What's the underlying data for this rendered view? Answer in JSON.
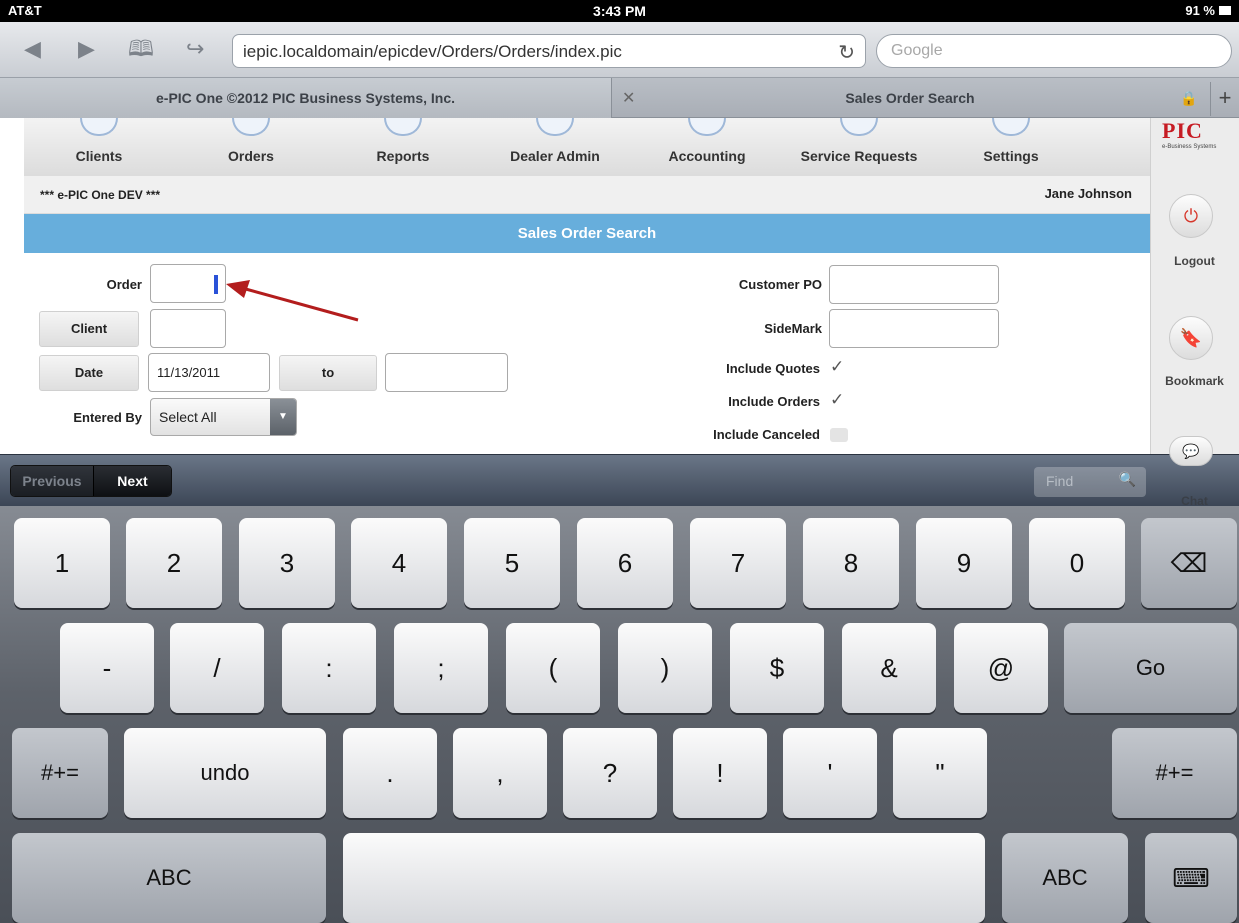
{
  "status_bar": {
    "carrier": "AT&T",
    "time": "3:43 PM",
    "battery": "91 %"
  },
  "browser": {
    "url": "iepic.localdomain/epicdev/Orders/Orders/index.pic",
    "search_placeholder": "Google",
    "tabs": [
      {
        "title": "e-PIC One  ©2012 PIC Business Systems, Inc."
      },
      {
        "title": "Sales Order Search"
      }
    ]
  },
  "nav": {
    "items": [
      {
        "label": "Clients"
      },
      {
        "label": "Orders"
      },
      {
        "label": "Reports"
      },
      {
        "label": "Dealer Admin"
      },
      {
        "label": "Accounting"
      },
      {
        "label": "Service Requests"
      },
      {
        "label": "Settings"
      }
    ]
  },
  "sidebar": {
    "logo_text": "PIC",
    "logo_sub": "e-Business Systems",
    "logout": "Logout",
    "bookmark": "Bookmark",
    "chat": "Chat"
  },
  "env_label": "*** e-PIC One DEV ***",
  "user_name": "Jane Johnson",
  "page_title": "Sales Order Search",
  "form": {
    "order_label": "Order",
    "order_value": "",
    "client_button": "Client",
    "client_value": "",
    "date_button": "Date",
    "date_from": "11/13/2011",
    "to_button": "to",
    "date_to": "",
    "entered_by_label": "Entered By",
    "entered_by_value": "Select All",
    "customer_po_label": "Customer PO",
    "customer_po_value": "",
    "sidemark_label": "SideMark",
    "sidemark_value": "",
    "include_quotes_label": "Include Quotes",
    "include_orders_label": "Include Orders",
    "include_canceled_label": "Include Canceled",
    "include_quotes": true,
    "include_orders": true,
    "include_canceled": false
  },
  "accessory": {
    "previous": "Previous",
    "next": "Next",
    "find_placeholder": "Find"
  },
  "keyboard": {
    "row1": [
      "1",
      "2",
      "3",
      "4",
      "5",
      "6",
      "7",
      "8",
      "9",
      "0"
    ],
    "row2": [
      "-",
      "/",
      ":",
      ";",
      "(",
      ")",
      "$",
      "&",
      "@"
    ],
    "go": "Go",
    "shift": "#+=",
    "undo": "undo",
    "row3": [
      ".",
      ",",
      "?",
      "!",
      "'",
      "\""
    ],
    "abc": "ABC"
  }
}
